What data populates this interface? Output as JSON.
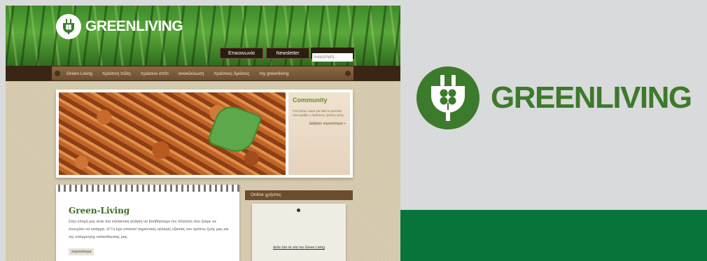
{
  "site": {
    "brand": "GREENLIVING",
    "top_buttons": [
      "Επικοινωνία",
      "Newsletter"
    ],
    "search_placeholder": "Αναζήτηση...",
    "nav": [
      "Green Living",
      "πράσινη πόλη",
      "πράσινο σπίτι",
      "ανακύκλωση",
      "πράσινες δράσεις",
      "my greenliving"
    ],
    "community": {
      "title": "Community",
      "text": "Γίνε μέλος τώρα για όλα τα μυστικά που κρύβει ο πράσινος τρόπος ζωής",
      "more": "Διάβασε περισσότερα »"
    },
    "intro": {
      "title": "Green-Living",
      "text": "Στην εποχή μας είναι πιο επιτακτική ανάγκη να βοηθήσουμε τον πλανήτη που ζούμε να συνεχίσει να υπάρχει. Η Γη έχει υποστεί σημαντικές αλλαγές εξαιτίας του τρόπου ζωής μας και της υπέρμετρης κατανάλωσης μας.",
      "read_more": "περισσότερα"
    },
    "online": {
      "header": "Online χρήστες",
      "link": "Δείτε όλα τα νέα του Green Living"
    }
  },
  "logo_large": {
    "text": "GREENLIVING",
    "color": "#3c7a2c"
  },
  "band_color": "#07743a"
}
